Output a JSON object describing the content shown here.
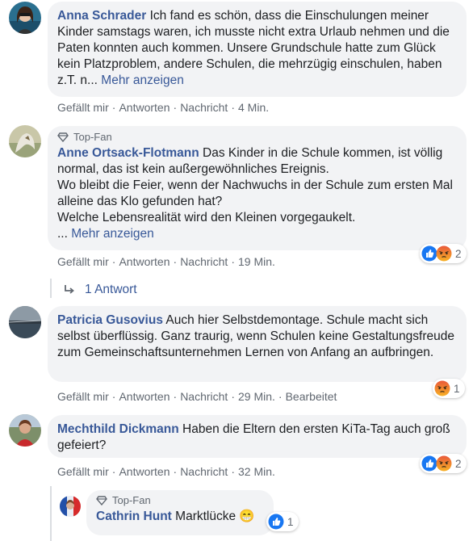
{
  "comments": [
    {
      "author": "Anna Schrader",
      "text": " Ich fand es schön, dass die Einschulungen meiner Kinder samstags waren, ich musste nicht extra Urlaub nehmen und die Paten konnten auch kommen. Unsere Grundschule hatte zum Glück kein Platzproblem, andere Schulen, die mehrzügig einschulen, haben z.T. n...",
      "more": "Mehr anzeigen",
      "actions": {
        "like": "Gefällt mir",
        "reply": "Antworten",
        "message": "Nachricht",
        "time": "4 Min."
      }
    },
    {
      "badge": "Top-Fan",
      "author": "Anne Ortsack-Flotmann",
      "text": " Das Kinder in die Schule kommen, ist völlig normal, das ist kein außergewöhnliches Ereignis.",
      "line2": "Wo bleibt die Feier, wenn der Nachwuchs in der Schule zum ersten Mal alleine das Klo gefunden hat?",
      "line3": "Welche Lebensrealität wird den Kleinen vorgegaukelt.",
      "ellipsis": "...",
      "more": "Mehr anzeigen",
      "reactions": {
        "count": "2",
        "types": [
          "like",
          "angry"
        ]
      },
      "actions": {
        "like": "Gefällt mir",
        "reply": "Antworten",
        "message": "Nachricht",
        "time": "19 Min."
      },
      "replies": "1 Antwort"
    },
    {
      "author": "Patricia Gusovius",
      "text": " Auch hier Selbstdemontage. Schule macht sich selbst überflüssig. Ganz traurig, wenn Schulen keine Gestaltungsfreude zum Gemeinschaftsunternehmen Lernen von Anfang an aufbringen.",
      "reactions": {
        "count": "1",
        "types": [
          "angry"
        ]
      },
      "actions": {
        "like": "Gefällt mir",
        "reply": "Antworten",
        "message": "Nachricht",
        "time": "29 Min.",
        "edited": "Bearbeitet"
      }
    },
    {
      "author": "Mechthild Dickmann",
      "text": " Haben die Eltern den ersten KiTa-Tag auch groß gefeiert?",
      "reactions": {
        "count": "2",
        "types": [
          "like",
          "angry"
        ]
      },
      "actions": {
        "like": "Gefällt mir",
        "reply": "Antworten",
        "message": "Nachricht",
        "time": "32 Min."
      }
    }
  ],
  "reply": {
    "badge": "Top-Fan",
    "author": "Cathrin Hunt",
    "text": " Marktlücke",
    "emoji": "😁",
    "reactions": {
      "count": "1",
      "types": [
        "like"
      ]
    }
  },
  "colors": {
    "link": "#385898",
    "bubble": "#f2f3f5",
    "meta": "#606770",
    "like": "#1877f2",
    "angry": "#f0643c"
  }
}
